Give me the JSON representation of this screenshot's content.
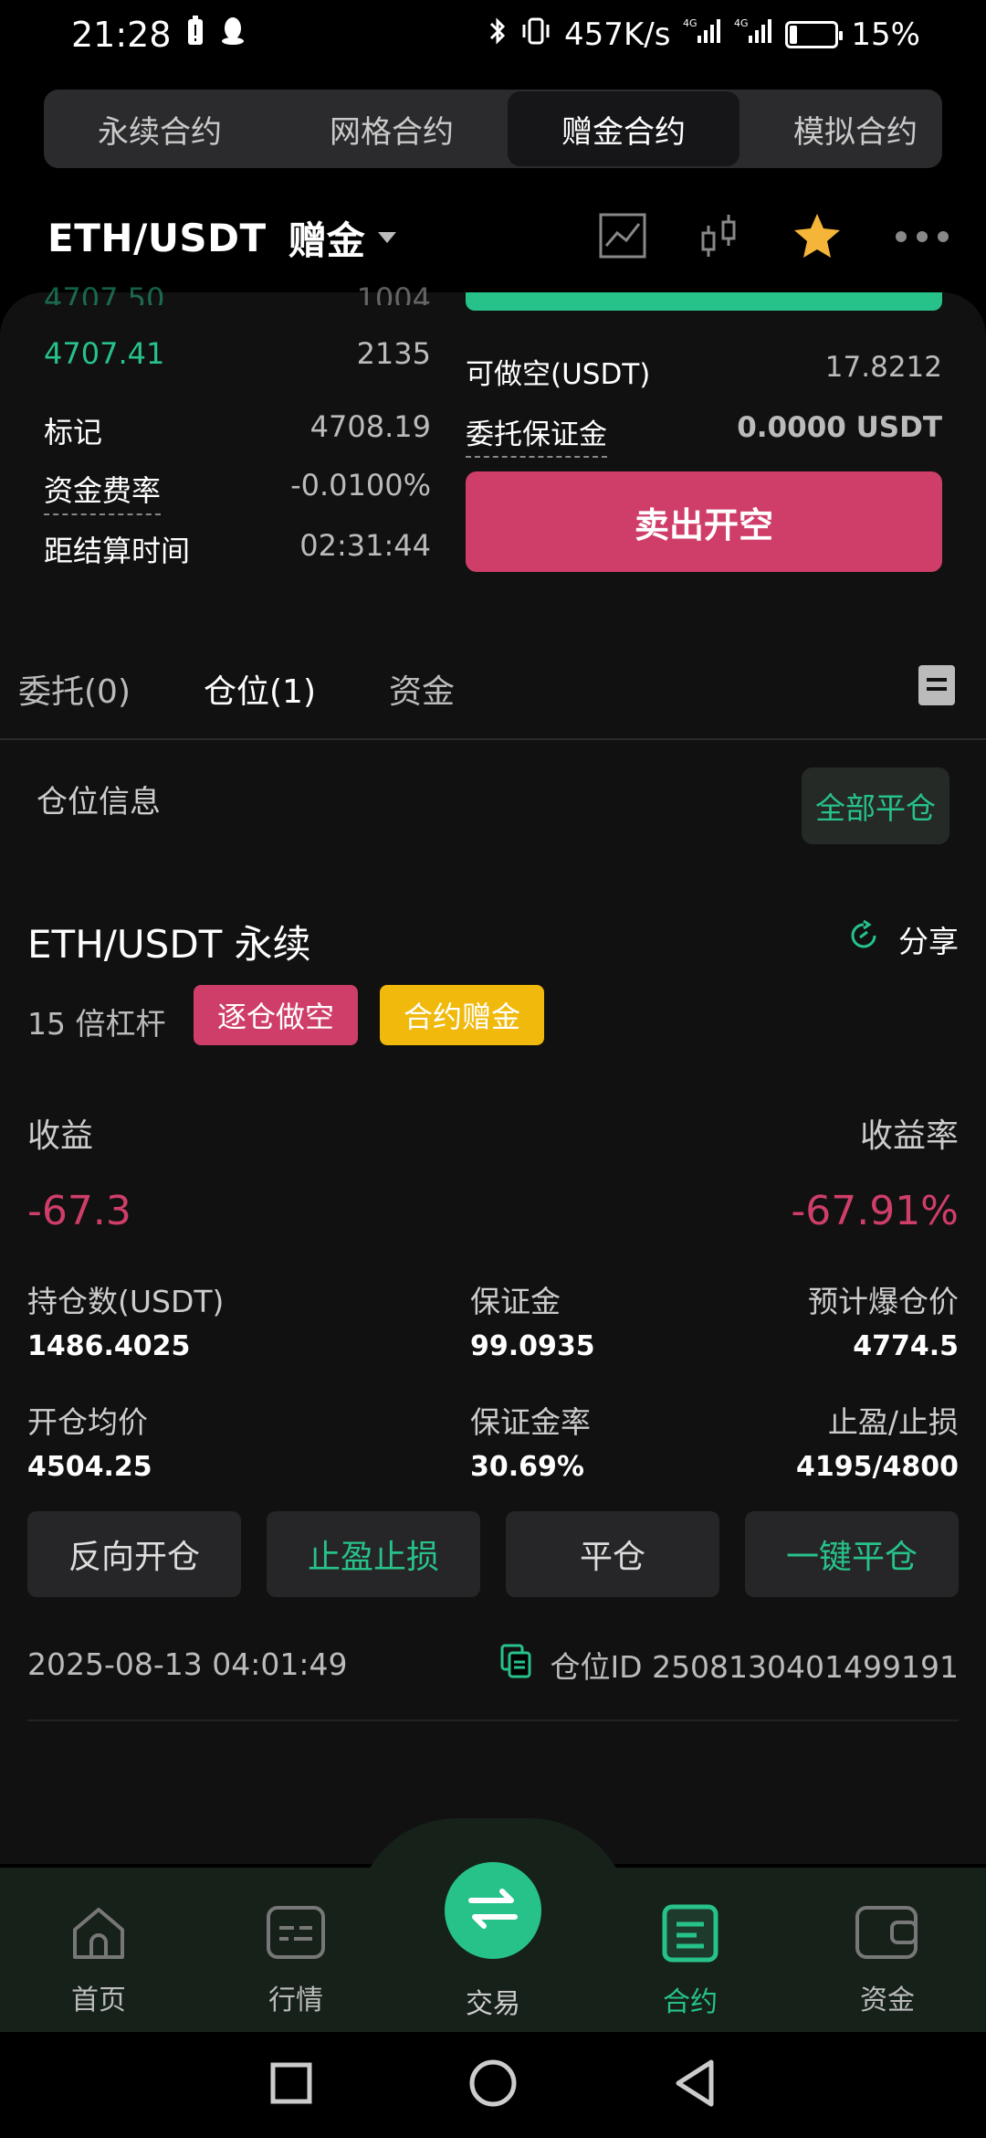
{
  "status": {
    "time": "21:28",
    "speed": "457K/s",
    "battery": "15%",
    "battery_level": 0.15
  },
  "contract_tabs": [
    "永续合约",
    "网格合约",
    "赠金合约",
    "模拟合约"
  ],
  "header": {
    "pair": "ETH/USDT",
    "bonus": "赠金"
  },
  "orderbook": {
    "partial_price": "4707.50",
    "partial_qty": "1004",
    "price": "4707.41",
    "qty": "2135"
  },
  "info": {
    "mark_label": "标记",
    "mark_value": "4708.19",
    "funding_label": "资金费率",
    "funding_value": "-0.0100%",
    "settle_label": "距结算时间",
    "settle_value": "02:31:44"
  },
  "trade_panel": {
    "short_avail_label": "可做空(USDT)",
    "short_avail_value": "17.8212",
    "margin_label": "委托保证金",
    "margin_value": "0.0000 USDT",
    "sell_label": "卖出开空"
  },
  "pos_tabs": [
    "委托(0)",
    "仓位(1)",
    "资金"
  ],
  "section": {
    "title": "仓位信息",
    "close_all": "全部平仓"
  },
  "position": {
    "name": "ETH/USDT 永续",
    "share": "分享",
    "leverage": "15 倍杠杆",
    "badge_short": "逐仓做空",
    "badge_bonus": "合约赠金",
    "pnl_label": "收益",
    "pnl_value": "-67.3",
    "roe_label": "收益率",
    "roe_value": "-67.91%",
    "size_label": "持仓数(USDT)",
    "size_value": "1486.4025",
    "margin_label": "保证金",
    "margin_value": "99.0935",
    "liq_label": "预计爆仓价",
    "liq_value": "4774.5",
    "entry_label": "开仓均价",
    "entry_value": "4504.25",
    "ratio_label": "保证金率",
    "ratio_value": "30.69%",
    "tpsl_label": "止盈/止损",
    "tpsl_value": "4195/4800",
    "buttons": [
      "反向开仓",
      "止盈止损",
      "平仓",
      "一键平仓"
    ],
    "timestamp": "2025-08-13 04:01:49",
    "id_text": "仓位ID 2508130401499191"
  },
  "nav": [
    "首页",
    "行情",
    "交易",
    "合约",
    "资金"
  ],
  "colors": {
    "green": "#27c28a",
    "red": "#cf3e69",
    "yellow": "#f0b90b"
  }
}
